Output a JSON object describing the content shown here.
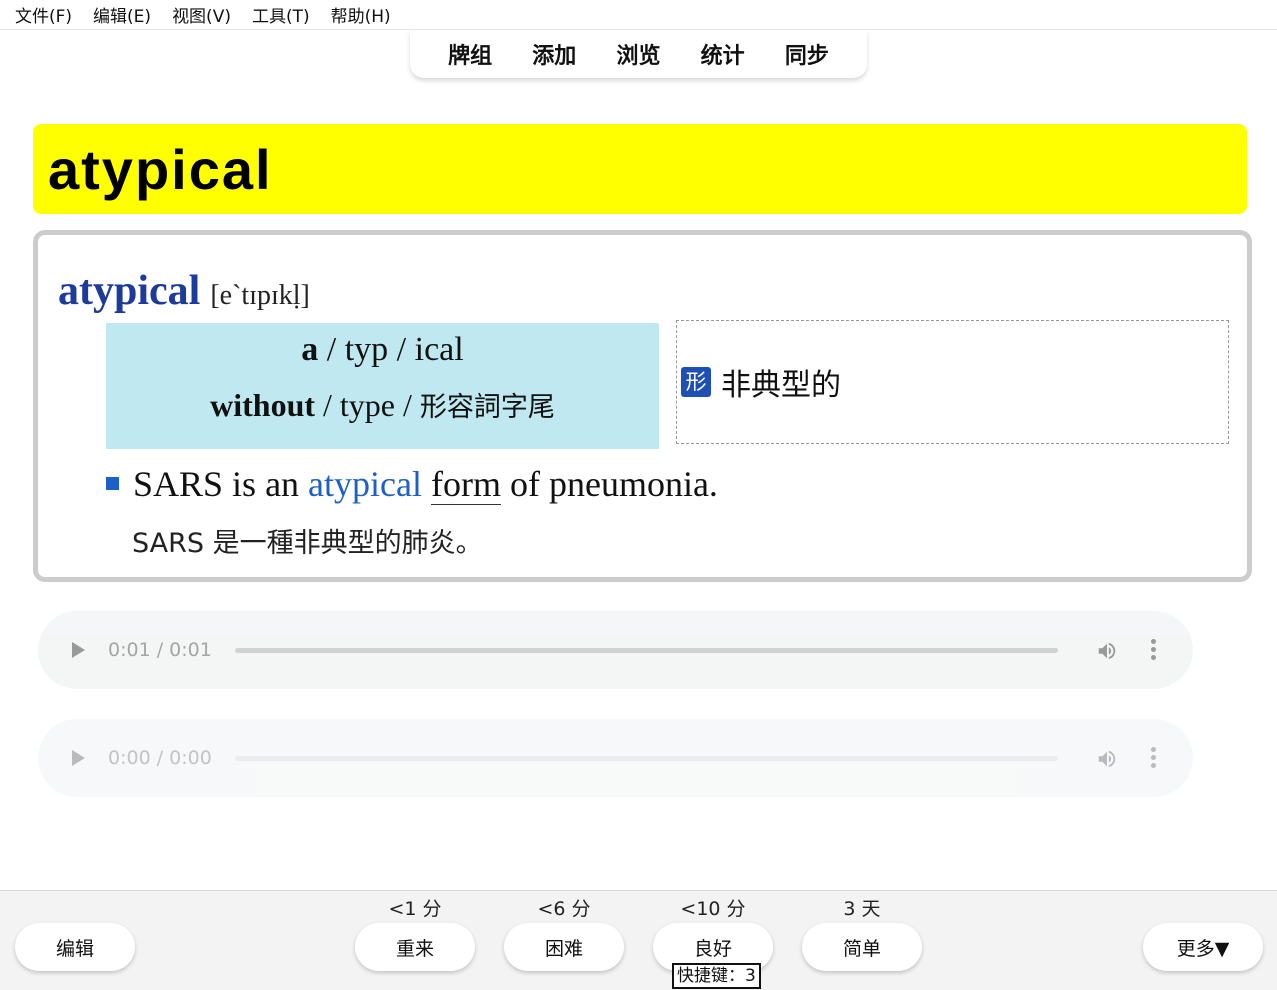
{
  "menu": [
    "文件(F)",
    "编辑(E)",
    "视图(V)",
    "工具(T)",
    "帮助(H)"
  ],
  "nav_tabs": [
    "牌组",
    "添加",
    "浏览",
    "统计",
    "同步"
  ],
  "card": {
    "front_word": "atypical",
    "headword": "atypical",
    "phonetic": "[e`tɪpɪkḷ]",
    "etymology": {
      "row1_parts": [
        "a",
        " / typ / ical"
      ],
      "row2_bold": "without",
      "row2_mid": " / type / ",
      "row2_cn": "形容詞字尾"
    },
    "pos": "形",
    "meaning": "非典型的",
    "example": {
      "pre": "SARS is an ",
      "keyword": "atypical",
      "space": " ",
      "underlined": "form",
      "post": " of pneumonia.",
      "translation": "SARS 是一種非典型的肺炎。"
    }
  },
  "audio": [
    {
      "time": "0:01 / 0:01"
    },
    {
      "time": "0:00 / 0:00"
    }
  ],
  "bottom": {
    "edit_label": "编辑",
    "more_label": "更多▼",
    "answers": [
      {
        "interval": "<1 分",
        "label": "重来"
      },
      {
        "interval": "<6 分",
        "label": "困难"
      },
      {
        "interval": "<10 分",
        "label": "良好"
      },
      {
        "interval": "3 天",
        "label": "简单"
      }
    ],
    "shortcut": "快捷键：3"
  },
  "colors": {
    "banner": "#ffff00",
    "headword": "#1d3b9c",
    "etym_bg": "#bfe8f0",
    "pos_badge": "#1d4fb4",
    "keyword": "#1d5fc8"
  }
}
